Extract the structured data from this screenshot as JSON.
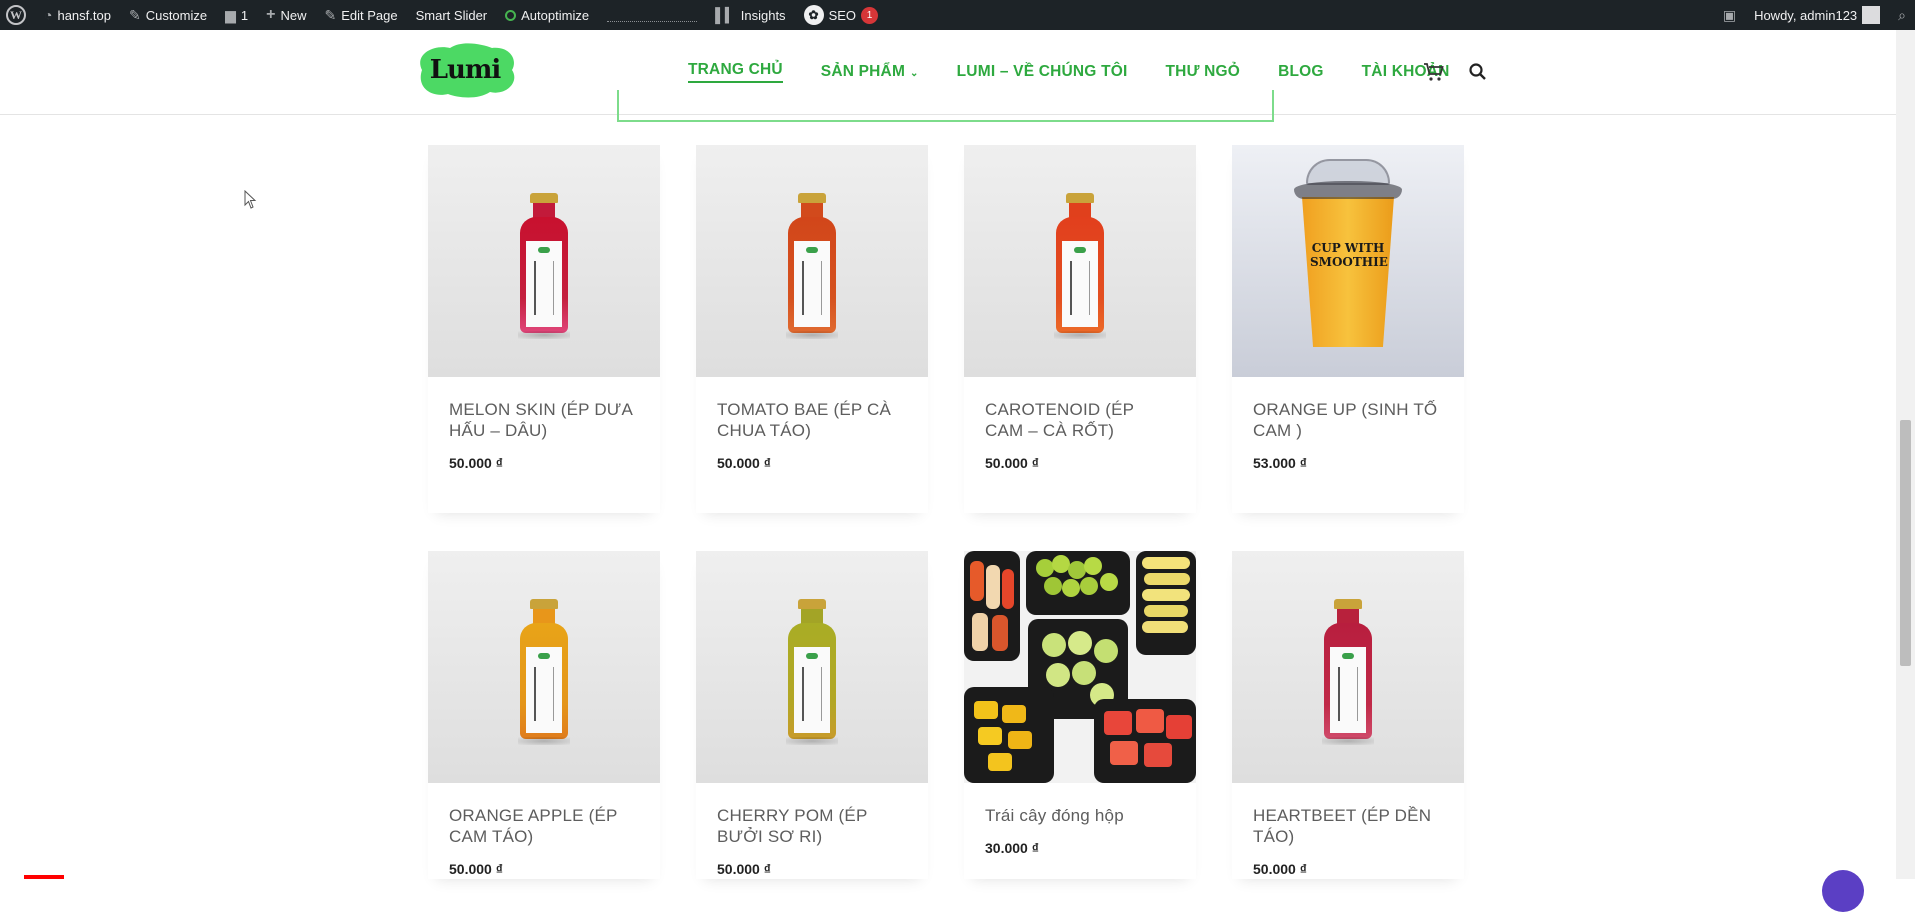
{
  "adminbar": {
    "site_name": "hansf.top",
    "customize": "Customize",
    "comments_count": "1",
    "new": "New",
    "edit_page": "Edit Page",
    "smart_slider": "Smart Slider",
    "autoptimize": "Autoptimize",
    "insights": "Insights",
    "seo": "SEO",
    "seo_badge": "1",
    "howdy": "Howdy, admin123"
  },
  "header": {
    "logo_text": "Lumi",
    "nav": [
      {
        "label": "TRANG CHỦ",
        "active": true
      },
      {
        "label": "SẢN PHẨM",
        "has_dropdown": true
      },
      {
        "label": "LUMI – VỀ CHÚNG TÔI"
      },
      {
        "label": "THƯ NGỎ"
      },
      {
        "label": "BLOG"
      },
      {
        "label": "TÀI KHOẢN"
      }
    ],
    "accent_color": "#2ea93f"
  },
  "products": [
    {
      "title": "MELON SKIN (ÉP DƯA HẤU – DÂU)",
      "price": "50.000 ₫",
      "image": "bottle-red"
    },
    {
      "title": "TOMATO BAE (ÉP CÀ CHUA TÁO)",
      "price": "50.000 ₫",
      "image": "bottle-orange-red"
    },
    {
      "title": "CAROTENOID (ÉP CAM – CÀ RỐT)",
      "price": "50.000 ₫",
      "image": "bottle-orange"
    },
    {
      "title": "ORANGE UP (SINH TỐ CAM )",
      "price": "53.000 ₫",
      "image": "cup-smoothie",
      "image_text": "CUP WITH SMOOTHIE"
    },
    {
      "title": "ORANGE APPLE (ÉP CAM TÁO)",
      "price": "50.000 ₫",
      "image": "bottle-amber"
    },
    {
      "title": "CHERRY POM (ÉP BƯỞI SƠ RI)",
      "price": "50.000 ₫",
      "image": "bottle-olive"
    },
    {
      "title": "Trái cây đóng hộp",
      "price": "30.000 ₫",
      "image": "fruit-boxes"
    },
    {
      "title": "HEARTBEET (ÉP DỀN TÁO)",
      "price": "50.000 ₫",
      "image": "bottle-beet"
    }
  ]
}
